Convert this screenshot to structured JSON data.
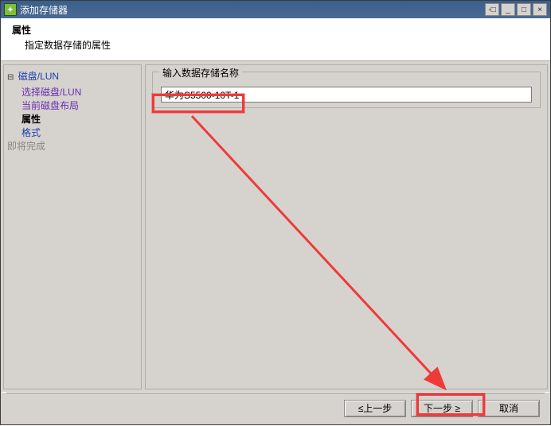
{
  "window": {
    "title": "添加存储器"
  },
  "header": {
    "title": "属性",
    "desc": "指定数据存储的属性"
  },
  "sidebar": {
    "root": "磁盘/LUN",
    "items": [
      "选择磁盘/LUN",
      "当前磁盘布局",
      "属性",
      "格式"
    ],
    "pending": "即将完成"
  },
  "main": {
    "group_label": "输入数据存储名称",
    "datastore_name": "华为S5500-10T-1"
  },
  "buttons": {
    "back": "≤上一步",
    "next": "下一步 ≥",
    "cancel": "取消"
  },
  "title_controls": {
    "pin": "-□",
    "min": "_",
    "max": "□",
    "close": "×"
  },
  "annotation_color": "#ef3a3a"
}
